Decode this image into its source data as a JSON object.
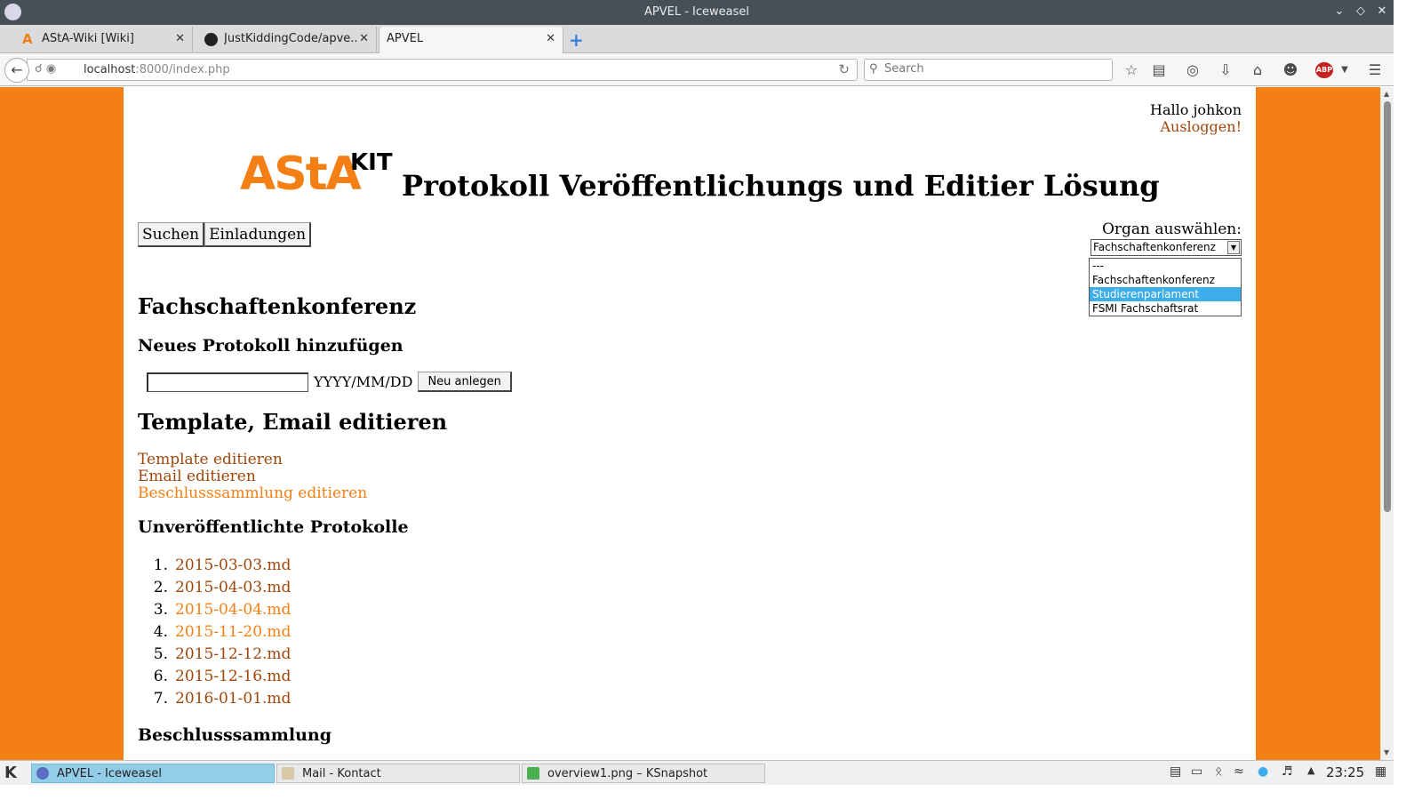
{
  "window": {
    "title": "APVEL - Iceweasel"
  },
  "tabs": [
    {
      "label": "AStA-Wiki [Wiki]"
    },
    {
      "label": "JustKiddingCode/apve..."
    },
    {
      "label": "APVEL"
    }
  ],
  "nav": {
    "url_host": "localhost",
    "url_rest": ":8000/index.php",
    "search_placeholder": "Search",
    "abp_label": "ABP"
  },
  "page": {
    "greeting": "Hallo johkon",
    "logout": "Ausloggen!",
    "logo_main": "AStA",
    "logo_kit": "KIT",
    "title": "Protokoll Veröffentlichungs und Editier Lösung",
    "menu": [
      "Suchen",
      "Einladungen"
    ],
    "organ_label": "Organ auswählen:",
    "organ_selected": "Fachschaftenkonferenz",
    "organ_options": [
      "---",
      "Fachschaftenkonferenz",
      "Studierenparlament",
      "FSMI Fachschaftsrat"
    ],
    "organ_highlight": "Studierenparlament",
    "org_heading": "Fachschaftenkonferenz",
    "new_heading": "Neues Protokoll hinzufügen",
    "date_format": "YYYY/MM/DD",
    "create_button": "Neu anlegen",
    "edit_heading": "Template, Email editieren",
    "edit_links": [
      "Template editieren",
      "Email editieren",
      "Beschlusssammlung editieren"
    ],
    "unpublished_heading": "Unveröffentlichte Protokolle",
    "protocols": [
      "2015-03-03.md",
      "2015-04-03.md",
      "2015-04-04.md",
      "2015-11-20.md",
      "2015-12-12.md",
      "2015-12-16.md",
      "2016-01-01.md"
    ],
    "decisions_heading": "Beschlusssammlung"
  },
  "taskbar": {
    "tasks": [
      "APVEL - Iceweasel",
      "Mail - Kontact",
      "overview1.png – KSnapshot"
    ],
    "clock": "23:25"
  },
  "colors": {
    "accent": "#f47f14",
    "link_visited": "#a0460a",
    "highlight": "#3daee9"
  }
}
